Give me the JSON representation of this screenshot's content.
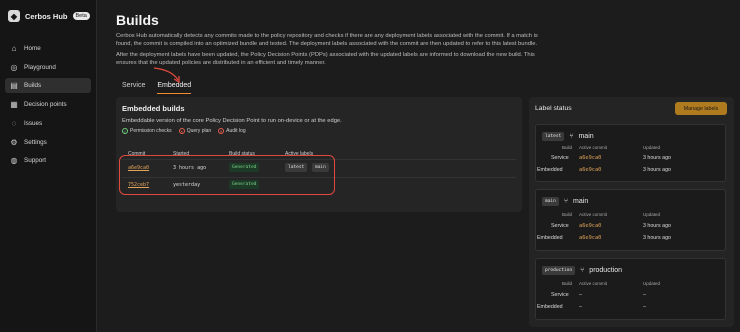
{
  "brand": {
    "name": "Cerbos Hub",
    "badge": "Beta"
  },
  "sidebar": {
    "items": [
      {
        "label": "Home",
        "icon": "home-icon",
        "glyph": "⌂"
      },
      {
        "label": "Playground",
        "icon": "playground-icon",
        "glyph": "◎"
      },
      {
        "label": "Builds",
        "icon": "builds-icon",
        "glyph": "▤"
      },
      {
        "label": "Decision points",
        "icon": "decision-points-icon",
        "glyph": "▦"
      },
      {
        "label": "Issues",
        "icon": "issues-icon",
        "glyph": "◌"
      },
      {
        "label": "Settings",
        "icon": "gear-icon",
        "glyph": "⚙"
      },
      {
        "label": "Support",
        "icon": "support-icon",
        "glyph": "◍"
      }
    ],
    "active_index": 2
  },
  "page": {
    "title": "Builds",
    "desc_line1": "Cerbos Hub automatically detects any commits made to the policy repository and checks if there are any deployment labels associated with the commit. If a match is",
    "desc_line2": "found, the commit is compiled into an optimized bundle and tested. The deployment labels associated with the commit are then updated to refer to this latest bundle.",
    "desc_line3": "After the deployment labels have been updated, the Policy Decision Points (PDPs) associated with the updated labels are informed to download the new build. This",
    "desc_line4": "ensures that the updated policies are distributed in an efficient and timely manner."
  },
  "tabs": [
    {
      "label": "Service",
      "active": false
    },
    {
      "label": "Embedded",
      "active": true
    }
  ],
  "embedded": {
    "title": "Embedded builds",
    "subtitle": "Embeddable version of the core Policy Decision Point to run on-device or at the edge.",
    "features": [
      {
        "label": "Permission checks",
        "enabled": true,
        "glyph": "✓"
      },
      {
        "label": "Query plan",
        "enabled": false,
        "glyph": "✕"
      },
      {
        "label": "Audit log",
        "enabled": false,
        "glyph": "✕"
      }
    ],
    "columns": {
      "commit": "Commit",
      "started": "Started",
      "status": "Build status",
      "labels": "Active labels"
    },
    "rows": [
      {
        "commit": "a6e9ca0",
        "started": "3 hours ago",
        "status": "Generated",
        "labels": [
          "latest",
          "main"
        ]
      },
      {
        "commit": "752ceb7",
        "started": "yesterday",
        "status": "Generated",
        "labels": []
      }
    ]
  },
  "label_status": {
    "title": "Label status",
    "manage_button": "Manage labels",
    "col_build": "Build",
    "col_commit": "Active commit",
    "col_updated": "Updated",
    "row_service": "Service",
    "row_embedded": "Embedded",
    "cards": [
      {
        "tag": "latest",
        "name": "main",
        "service_commit": "a6e9ca0",
        "service_updated": "3 hours ago",
        "embedded_commit": "a6e9ca0",
        "embedded_updated": "3 hours ago"
      },
      {
        "tag": "main",
        "name": "main",
        "service_commit": "a6e9ca0",
        "service_updated": "3 hours ago",
        "embedded_commit": "a6e9ca0",
        "embedded_updated": "3 hours ago"
      },
      {
        "tag": "production",
        "name": "production",
        "service_commit": "–",
        "service_updated": "–",
        "embedded_commit": "–",
        "embedded_updated": "–"
      }
    ]
  },
  "colors": {
    "accent": "#f08b2f",
    "commit": "#e0a35a",
    "highlight": "#e0493e",
    "generated": "#7fd38c"
  }
}
